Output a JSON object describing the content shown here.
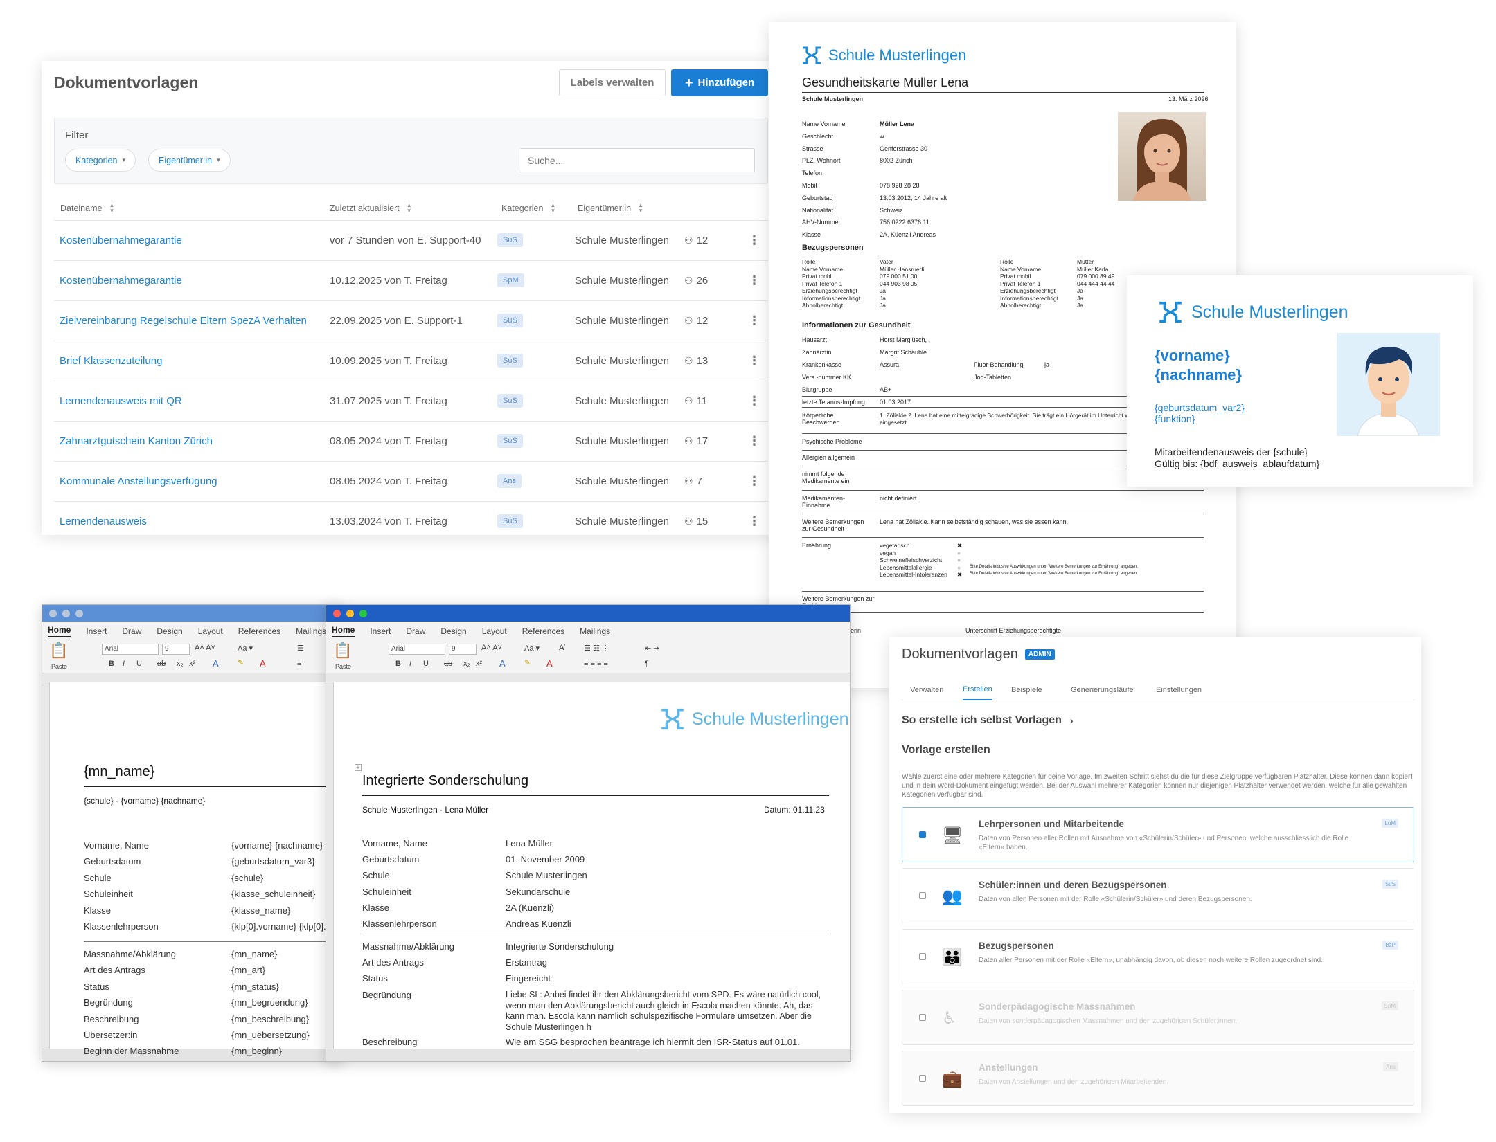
{
  "list": {
    "title": "Dokumentvorlagen",
    "labels_btn": "Labels verwalten",
    "add_btn": "Hinzufügen",
    "filter_label": "Filter",
    "chip_categories": "Kategorien",
    "chip_owner": "Eigentümer:in",
    "search_placeholder": "Suche...",
    "col_name": "Dateiname",
    "col_updated": "Zuletzt aktualisiert",
    "col_categories": "Kategorien",
    "col_owner": "Eigentümer:in",
    "rows": [
      {
        "name": "Kostenübernahmegarantie",
        "updated": "vor 7 Stunden von E. Support-40",
        "cat": "SuS",
        "owner": "Schule Musterlingen",
        "count": "12"
      },
      {
        "name": "Kostenübernahmegarantie",
        "updated": "10.12.2025 von T. Freitag",
        "cat": "SpM",
        "owner": "Schule Musterlingen",
        "count": "26"
      },
      {
        "name": "Zielvereinbarung Regelschule Eltern SpezA Verhalten",
        "updated": "22.09.2025 von E. Support-1",
        "cat": "SuS",
        "owner": "Schule Musterlingen",
        "count": "12"
      },
      {
        "name": "Brief Klassenzuteilung",
        "updated": "10.09.2025 von T. Freitag",
        "cat": "SuS",
        "owner": "Schule Musterlingen",
        "count": "13"
      },
      {
        "name": "Lernendenausweis mit QR",
        "updated": "31.07.2025 von T. Freitag",
        "cat": "SuS",
        "owner": "Schule Musterlingen",
        "count": "11"
      },
      {
        "name": "Zahnarztgutschein Kanton Zürich",
        "updated": "08.05.2024 von T. Freitag",
        "cat": "SuS",
        "owner": "Schule Musterlingen",
        "count": "17"
      },
      {
        "name": "Kommunale Anstellungsverfügung",
        "updated": "08.05.2024 von T. Freitag",
        "cat": "Ans",
        "owner": "Schule Musterlingen",
        "count": "7"
      },
      {
        "name": "Lernendenausweis",
        "updated": "13.03.2024 von T. Freitag",
        "cat": "SuS",
        "owner": "Schule Musterlingen",
        "count": "15"
      }
    ]
  },
  "health": {
    "brand": "Schule Musterlingen",
    "title": "Gesundheitskarte Müller Lena",
    "school": "Schule Musterlingen",
    "date": "13. März 2026",
    "fields": [
      {
        "k": "Name Vorname",
        "v": "Müller Lena"
      },
      {
        "k": "Geschlecht",
        "v": "w"
      },
      {
        "k": "Strasse",
        "v": "Genferstrasse 30"
      },
      {
        "k": "PLZ, Wohnort",
        "v": "8002 Zürich"
      },
      {
        "k": "Telefon",
        "v": ""
      },
      {
        "k": "Mobil",
        "v": "078 928 28 28"
      },
      {
        "k": "Geburtstag",
        "v": "13.03.2012, 14 Jahre alt"
      },
      {
        "k": "Nationalität",
        "v": "Schweiz"
      },
      {
        "k": "AHV-Nummer",
        "v": "756.0222.6376.11"
      },
      {
        "k": "Klasse",
        "v": "2A, Küenzli Andreas"
      }
    ],
    "bezug_title": "Bezugspersonen",
    "bezug_keys": [
      "Rolle",
      "Name Vorname",
      "Privat mobil",
      "Privat Telefon 1",
      "Erziehungsberechtigt",
      "Informationsberechtigt",
      "Abholberechtigt"
    ],
    "bezug1": [
      "Vater",
      "Müller Hansruedi",
      "079 000 51 00",
      "044 903 98 05",
      "Ja",
      "Ja",
      "Ja"
    ],
    "bezug2": [
      "Mutter",
      "Müller Karla",
      "079 000 89 49",
      "044 444 44 44",
      "Ja",
      "Ja",
      "Ja"
    ],
    "info_title": "Informationen zur Gesundheit",
    "info": [
      {
        "k": "Hausarzt",
        "v": "Horst Marglüsch, ,"
      },
      {
        "k": "Zahnärztin",
        "v": "Margrit Schäuble"
      },
      {
        "k": "Krankenkasse",
        "v": "Assura"
      },
      {
        "k": "Vers.-nummer KK",
        "v": ""
      },
      {
        "k": "Blutgruppe",
        "v": "AB+"
      },
      {
        "k": "letzte Tetanus-Impfung",
        "v": "01.03.2017"
      }
    ],
    "fluor_k": "Fluor-Behandlung",
    "fluor_v": "ja",
    "jod_k": "Jod-Tabletten",
    "koerper_k": "Körperliche Beschwerden",
    "koerper_v": "1. Zöliakie 2. Lena hat eine mittelgradige Schwerhörigkeit. Sie trägt ein Hörgerät im Unterricht wird eine FM-Anlage eingesetzt.",
    "psych_k": "Psychische Probleme",
    "allerg_k": "Allergien allgemein",
    "medi_k": "nimmt folgende Medikamente ein",
    "medi_e_k": "Medikamenten-Einnahme",
    "medi_e_v": "nicht definiert",
    "bem_k": "Weitere Bemerkungen zur Gesundheit",
    "bem_v": "Lena hat Zöliakie. Kann selbstständig schauen, was sie essen kann.",
    "ern_k": "Ernährung",
    "ern_opts": [
      "vegetarisch",
      "vegan",
      "Schweinefleischverzicht",
      "Lebensmittelallergie",
      "Lebensmittel-Intoleranzen"
    ],
    "ern_note": "Bitte Details inklusive Auswirkungen unter \"Weitere Bemerkungen zur Ernährung\" angeben.",
    "bem_ern_k": "Weitere Bemerkungen zur Ernährung",
    "sig_left": "lerin",
    "sig_right": "Unterschrift Erziehungsberechtigte"
  },
  "emp": {
    "brand": "Schule Musterlingen",
    "name1": "{vorname}",
    "name2": "{nachname}",
    "small1": "{geburtsdatum_var2}",
    "small2": "{funktion}",
    "foot1": "Mitarbeitendenausweis der {schule}",
    "foot2": "Gültig bis: {bdf_ausweis_ablaufdatum}"
  },
  "word_tabs": [
    "Home",
    "Insert",
    "Draw",
    "Design",
    "Layout",
    "References",
    "Mailings"
  ],
  "word1": {
    "font": "Arial",
    "size": "9",
    "paste": "Paste",
    "heading": "{mn_name}",
    "sub": "{schule} · {vorname} {nachname}",
    "rows1": [
      {
        "k": "Vorname, Name",
        "v": "{vorname} {nachname}"
      },
      {
        "k": "Geburtsdatum",
        "v": "{geburtsdatum_var3}"
      },
      {
        "k": "Schule",
        "v": "{schule}"
      },
      {
        "k": "Schuleinheit",
        "v": "{klasse_schuleinheit}"
      },
      {
        "k": "Klasse",
        "v": "{klasse_name}"
      },
      {
        "k": "Klassenlehrperson",
        "v": "{klp[0].vorname} {klp[0]."
      }
    ],
    "rows2": [
      {
        "k": "Massnahme/Abklärung",
        "v": "{mn_name}"
      },
      {
        "k": "Art des Antrags",
        "v": "{mn_art}"
      },
      {
        "k": "Status",
        "v": "{mn_status}"
      },
      {
        "k": "Begründung",
        "v": "{mn_begruendung}"
      },
      {
        "k": "Beschreibung",
        "v": "{mn_beschreibung}"
      },
      {
        "k": "Übersetzer:in",
        "v": "{mn_uebersetzung}"
      },
      {
        "k": "Beginn der Massnahme",
        "v": "{mn_beginn}"
      }
    ]
  },
  "word2": {
    "font": "Arial",
    "size": "9",
    "paste": "Paste",
    "brand": "Schule Musterlingen",
    "heading": "Integrierte Sonderschulung",
    "sub": "Schule Musterlingen · Lena Müller",
    "date": "Datum: 01.11.23",
    "rows1": [
      {
        "k": "Vorname, Name",
        "v": "Lena Müller"
      },
      {
        "k": "Geburtsdatum",
        "v": "01. November 2009"
      },
      {
        "k": "Schule",
        "v": "Schule Musterlingen"
      },
      {
        "k": "Schuleinheit",
        "v": "Sekundarschule"
      },
      {
        "k": "Klasse",
        "v": "2A (Küenzli)"
      },
      {
        "k": "Klassenlehrperson",
        "v": "Andreas Küenzli"
      }
    ],
    "rows2": [
      {
        "k": "Massnahme/Abklärung",
        "v": "Integrierte Sonderschulung"
      },
      {
        "k": "Art des Antrags",
        "v": "Erstantrag"
      },
      {
        "k": "Status",
        "v": "Eingereicht"
      }
    ],
    "begr_k": "Begründung",
    "begr_v": [
      "Liebe SL: Anbei findet ihr den Abklärungsbericht vom SPD. Es wäre natürlich cool,",
      "wenn man den Abklärungsbericht auch gleich in Escola machen könnte. Ah, das",
      "kann man. Escola kann nämlich schulspezifische Formulare umsetzen. Aber die",
      "Schule Musterlingen h"
    ],
    "besch_k": "Beschreibung",
    "besch_v": "Wie am SSG besprochen beantrage ich hiermit den ISR-Status auf 01.01."
  },
  "admin": {
    "title": "Dokumentvorlagen",
    "badge": "ADMIN",
    "tabs": [
      "Verwalten",
      "Erstellen",
      "Beispiele",
      "Generierungsläufe",
      "Einstellungen"
    ],
    "howto": "So erstelle ich selbst Vorlagen",
    "create": "Vorlage erstellen",
    "intro": "Wähle zuerst eine oder mehrere Kategorien für deine Vorlage. Im zweiten Schritt siehst du die für diese Zielgruppe verfügbaren Platzhalter. Diese können dann kopiert und in dein Word-Dokument eingefügt werden. Bei der Auswahl mehrerer Kategorien können nur diejenigen Platzhalter verwendet werden, welche für alle gewählten Kategorien verfügbar sind.",
    "options": [
      {
        "title": "Lehrpersonen und Mitarbeitende",
        "desc": "Daten von Personen aller Rollen mit Ausnahme von «Schülerin/Schüler» und Personen, welche ausschliesslich die Rolle «Eltern» haben.",
        "tag": "LuM"
      },
      {
        "title": "Schüler:innen und deren Bezugspersonen",
        "desc": "Daten von allen Personen mit der Rolle «Schülerin/Schüler» und deren Bezugspersonen.",
        "tag": "SuS"
      },
      {
        "title": "Bezugspersonen",
        "desc": "Daten aller Personen mit der Rolle «Eltern», unabhängig davon, ob diesen noch weitere Rollen zugeordnet sind.",
        "tag": "BzP"
      },
      {
        "title": "Sonderpädagogische Massnahmen",
        "desc": "Daten von sonderpädagogischen Massnahmen und den zugehörigen Schüler:innen.",
        "tag": "SpM"
      },
      {
        "title": "Anstellungen",
        "desc": "Daten von Anstellungen und den zugehörigen Mitarbeitenden.",
        "tag": "Ans"
      }
    ]
  }
}
